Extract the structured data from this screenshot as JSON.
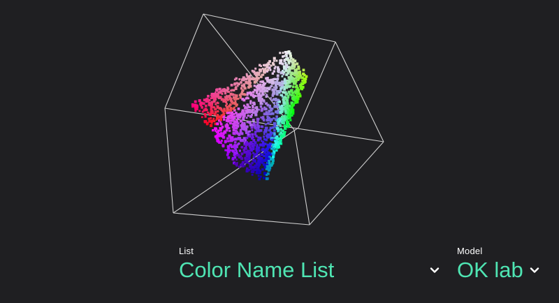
{
  "visualization": {
    "name": "color-space-cube",
    "colors": {
      "background": "#1f1f22",
      "cube_edge": "#cfcfcf",
      "accent": "#4fe5b3"
    }
  },
  "controls": {
    "list": {
      "label": "List",
      "value": "Color Name List"
    },
    "model": {
      "label": "Model",
      "value": "OK lab"
    }
  }
}
